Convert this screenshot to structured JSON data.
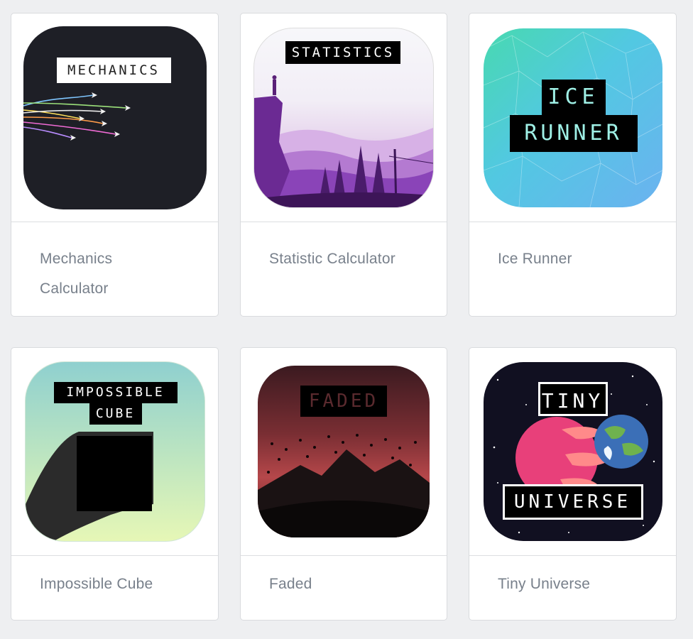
{
  "apps": [
    {
      "title": "Mechanics Calculator",
      "icon": "mechanics-app-icon",
      "icon_text": "MECHANICS"
    },
    {
      "title": "Statistic Calculator",
      "icon": "statistics-app-icon",
      "icon_text": "STATISTICS"
    },
    {
      "title": "Ice Runner",
      "icon": "ice-runner-app-icon",
      "icon_text": [
        "ICE",
        "RUNNER"
      ]
    },
    {
      "title": "Impossible Cube",
      "icon": "impossible-cube-app-icon",
      "icon_text": [
        "IMPOSSIBLE",
        "CUBE"
      ]
    },
    {
      "title": "Faded",
      "icon": "faded-app-icon",
      "icon_text": "FADED"
    },
    {
      "title": "Tiny Universe",
      "icon": "tiny-universe-app-icon",
      "icon_text": [
        "TINY",
        "UNIVERSE"
      ]
    }
  ],
  "colors": {
    "page_background": "#eeeff1",
    "card_background": "#ffffff",
    "card_border": "#d9dbde",
    "title_text": "#78808b"
  }
}
